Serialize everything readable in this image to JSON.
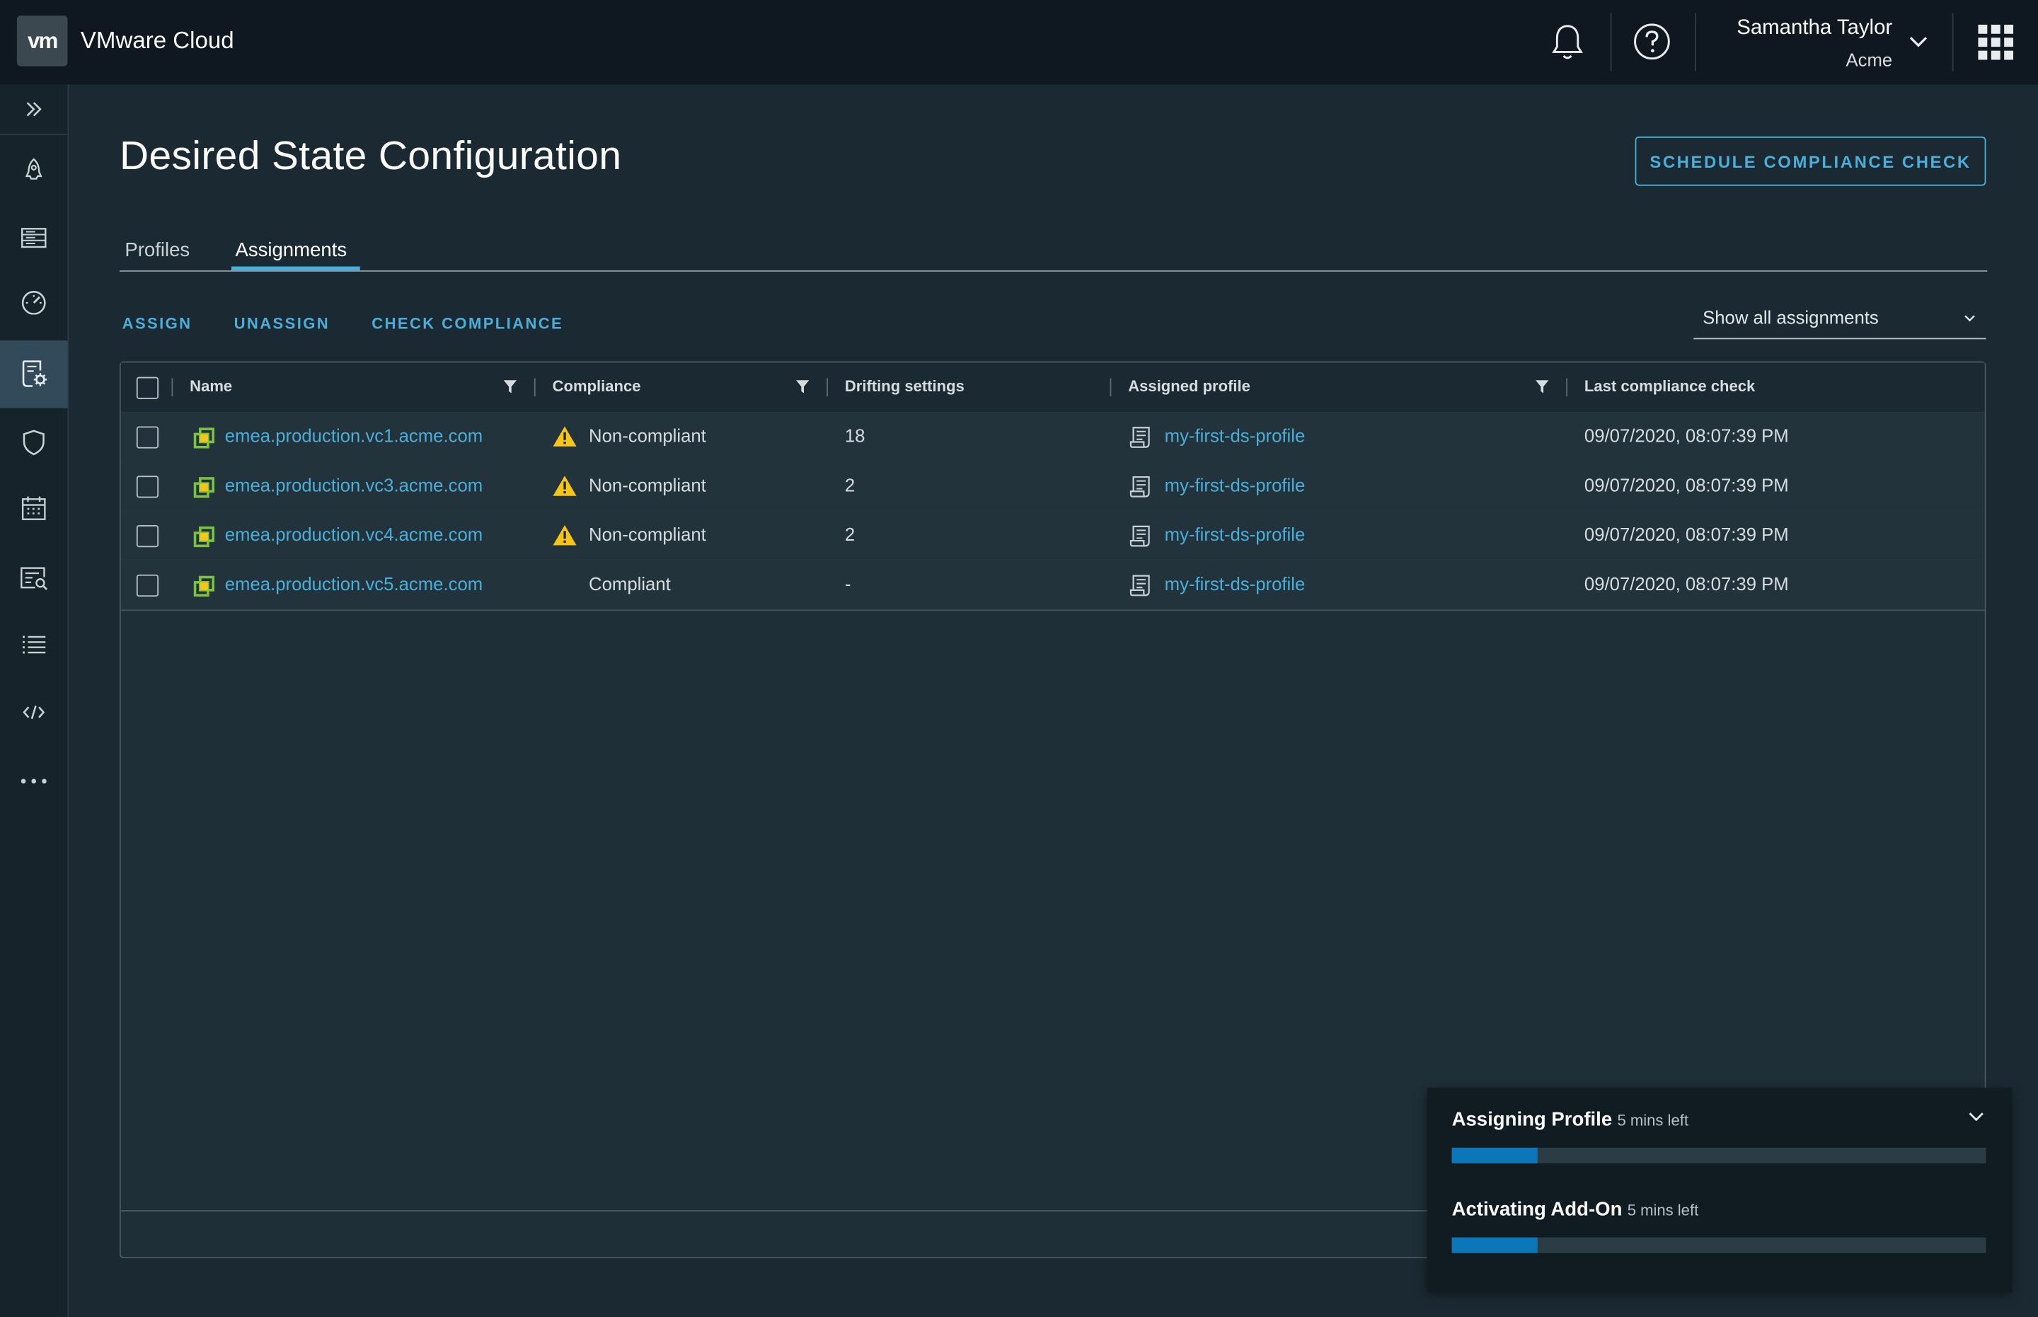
{
  "header": {
    "logo_text": "vm",
    "app_title": "VMware Cloud",
    "user_name": "Samantha Taylor",
    "org_name": "Acme"
  },
  "sidebar": {
    "items": [
      {
        "icon": "expand-double-chevron-icon"
      },
      {
        "icon": "rocket-icon"
      },
      {
        "icon": "list-view-icon"
      },
      {
        "icon": "dashboard-gauge-icon"
      },
      {
        "icon": "config-profile-icon",
        "active": true
      },
      {
        "icon": "shield-icon"
      },
      {
        "icon": "calendar-icon"
      },
      {
        "icon": "search-report-icon"
      },
      {
        "icon": "bullet-list-icon"
      },
      {
        "icon": "code-icon"
      },
      {
        "icon": "more-horizontal-icon"
      }
    ]
  },
  "page": {
    "title": "Desired State Configuration",
    "schedule_button": "SCHEDULE COMPLIANCE CHECK",
    "tabs": [
      {
        "label": "Profiles",
        "active": false
      },
      {
        "label": "Assignments",
        "active": true
      }
    ],
    "actions": {
      "assign": "ASSIGN",
      "unassign": "UNASSIGN",
      "check_compliance": "CHECK COMPLIANCE"
    },
    "filter_value": "Show all assignments"
  },
  "grid": {
    "columns": {
      "name": "Name",
      "compliance": "Compliance",
      "drifting": "Drifting settings",
      "profile": "Assigned profile",
      "last_check": "Last compliance check"
    },
    "rows": [
      {
        "name": "emea.production.vc1.acme.com",
        "compliance": "Non-compliant",
        "warning": true,
        "drifting": "18",
        "profile": "my-first-ds-profile",
        "last_check": "09/07/2020, 08:07:39 PM"
      },
      {
        "name": "emea.production.vc3.acme.com",
        "compliance": "Non-compliant",
        "warning": true,
        "drifting": "2",
        "profile": "my-first-ds-profile",
        "last_check": "09/07/2020, 08:07:39 PM"
      },
      {
        "name": "emea.production.vc4.acme.com",
        "compliance": "Non-compliant",
        "warning": true,
        "drifting": "2",
        "profile": "my-first-ds-profile",
        "last_check": "09/07/2020, 08:07:39 PM"
      },
      {
        "name": "emea.production.vc5.acme.com",
        "compliance": "Compliant",
        "warning": false,
        "drifting": "-",
        "profile": "my-first-ds-profile",
        "last_check": "09/07/2020, 08:07:39 PM"
      }
    ]
  },
  "tasks": [
    {
      "title": "Assigning Profile",
      "eta": "5 mins left",
      "progress": 0.16
    },
    {
      "title": "Activating Add-On",
      "eta": "5 mins left",
      "progress": 0.16
    }
  ],
  "colors": {
    "accent": "#4aaed9",
    "progress_fill": "#0b77b8",
    "warning": "#f5c518",
    "vcenter_green": "#7cc243"
  }
}
